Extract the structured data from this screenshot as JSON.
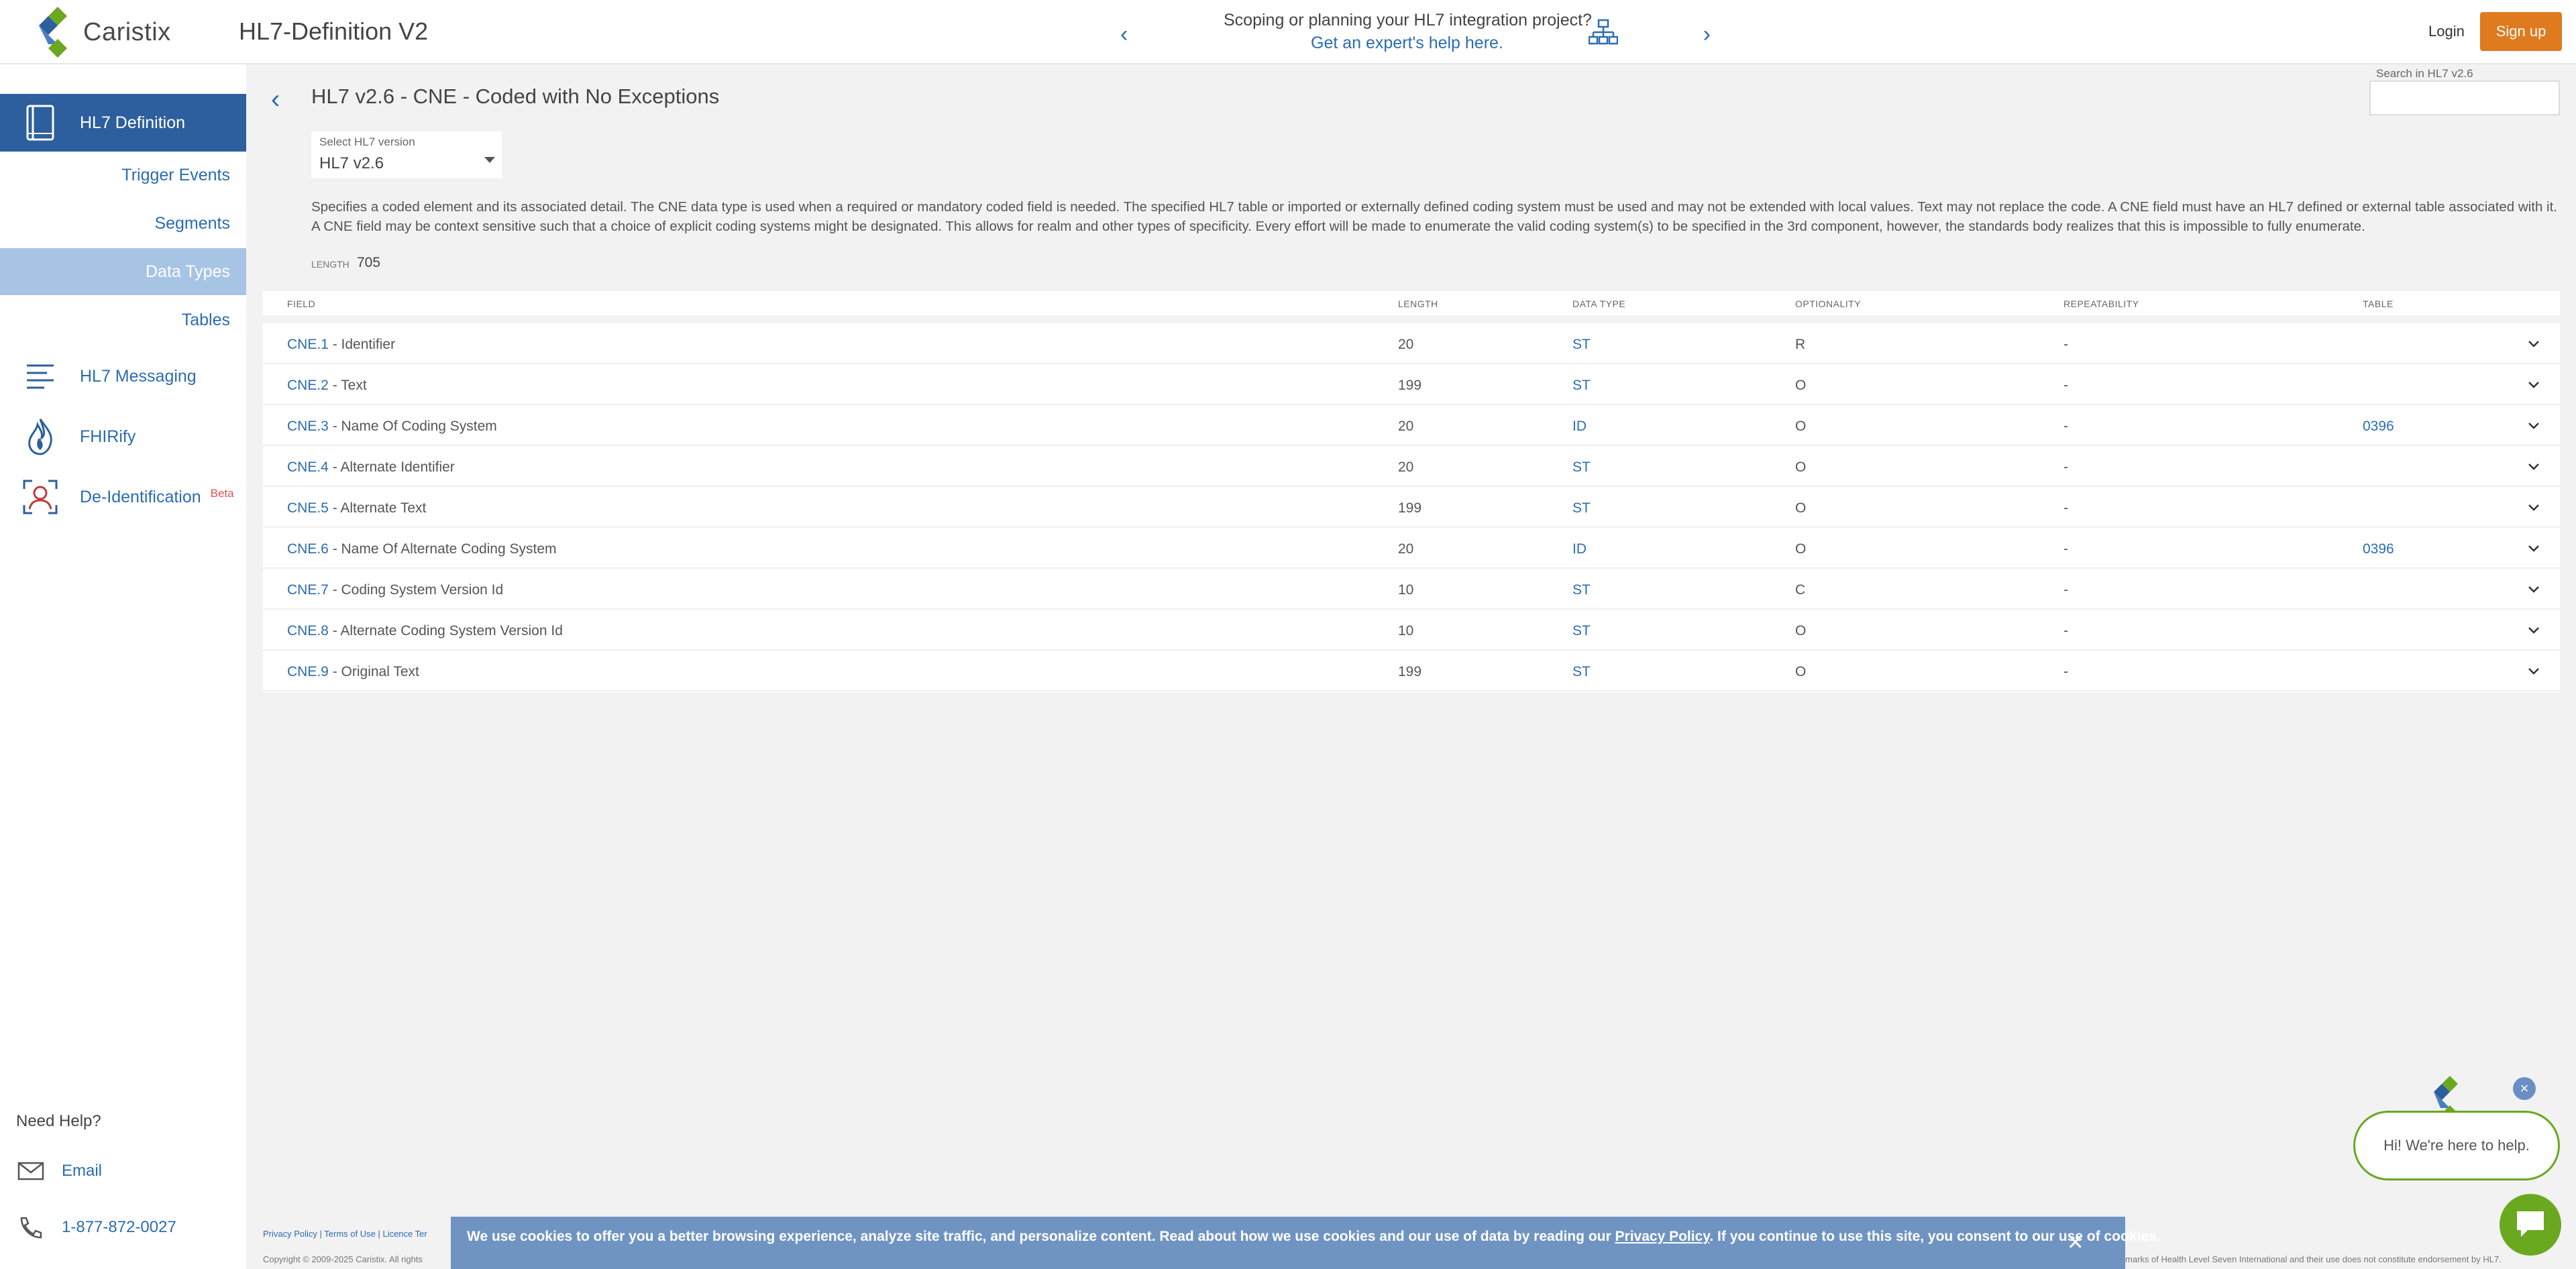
{
  "header": {
    "logo_text": "Caristix",
    "app_title": "HL7-Definition V2",
    "promo_line1": "Scoping or planning your HL7 integration project?",
    "promo_line2": "Get an expert's help here.",
    "login": "Login",
    "signup": "Sign up",
    "brand_color": "#e07a1f"
  },
  "sidebar": {
    "hl7_definition": "HL7 Definition",
    "sub_items": [
      "Trigger Events",
      "Segments",
      "Data Types",
      "Tables"
    ],
    "active_sub": "Data Types",
    "hl7_messaging": "HL7 Messaging",
    "fhirify": "FHIRify",
    "deidentification": "De-Identification",
    "beta": "Beta",
    "need_help": "Need Help?",
    "email": "Email",
    "phone": "1-877-872-0027"
  },
  "main": {
    "title": "HL7 v2.6 - CNE - Coded with No Exceptions",
    "search_label": "Search in HL7 v2.6",
    "version_label": "Select HL7 version",
    "version_value": "HL7 v2.6",
    "description": "Specifies a coded element and its associated detail. The CNE data type is used when a required or mandatory coded field is needed. The specified HL7 table or imported or externally defined coding system must be used and may not be extended with local values. Text may not replace the code. A CNE field must have an HL7 defined or external table associated with it. A CNE field may be context sensitive such that a choice of explicit coding systems might be designated. This allows for realm and other types of specificity. Every effort will be made to enumerate the valid coding system(s) to be specified in the 3rd component, however, the standards body realizes that this is impossible to fully enumerate.",
    "length_label": "LENGTH",
    "length_value": "705"
  },
  "table": {
    "headers": {
      "field": "FIELD",
      "length": "LENGTH",
      "data_type": "DATA TYPE",
      "optionality": "OPTIONALITY",
      "repeatability": "REPEATABILITY",
      "table": "TABLE"
    },
    "rows": [
      {
        "code": "CNE.1",
        "name": " - Identifier",
        "length": "20",
        "type": "ST",
        "opt": "R",
        "rep": "-",
        "table": ""
      },
      {
        "code": "CNE.2",
        "name": " - Text",
        "length": "199",
        "type": "ST",
        "opt": "O",
        "rep": "-",
        "table": ""
      },
      {
        "code": "CNE.3",
        "name": " - Name Of Coding System",
        "length": "20",
        "type": "ID",
        "opt": "O",
        "rep": "-",
        "table": "0396"
      },
      {
        "code": "CNE.4",
        "name": " - Alternate Identifier",
        "length": "20",
        "type": "ST",
        "opt": "O",
        "rep": "-",
        "table": ""
      },
      {
        "code": "CNE.5",
        "name": " - Alternate Text",
        "length": "199",
        "type": "ST",
        "opt": "O",
        "rep": "-",
        "table": ""
      },
      {
        "code": "CNE.6",
        "name": " - Name Of Alternate Coding System",
        "length": "20",
        "type": "ID",
        "opt": "O",
        "rep": "-",
        "table": "0396"
      },
      {
        "code": "CNE.7",
        "name": " - Coding System Version Id",
        "length": "10",
        "type": "ST",
        "opt": "C",
        "rep": "-",
        "table": ""
      },
      {
        "code": "CNE.8",
        "name": " - Alternate Coding System Version Id",
        "length": "10",
        "type": "ST",
        "opt": "O",
        "rep": "-",
        "table": ""
      },
      {
        "code": "CNE.9",
        "name": " - Original Text",
        "length": "199",
        "type": "ST",
        "opt": "O",
        "rep": "-",
        "table": ""
      }
    ]
  },
  "footer": {
    "links": "Privacy Policy | Terms of Use | Licence Ter",
    "copyright": "Copyright © 2009-2025 Caristix. All rights",
    "trademark": "marks of Health Level Seven International and their use does not constitute endorsement by HL7."
  },
  "cookie": {
    "text_before": "We use cookies to offer you a better browsing experience, analyze site traffic, and personalize content. Read about how we use cookies and our use of data by reading our ",
    "link": "Privacy Policy",
    "text_after": ". If you continue to use this site, you consent to our use of cookies."
  },
  "chat": {
    "greeting": "Hi! We're here to help.",
    "accent_color": "#6aa820"
  }
}
